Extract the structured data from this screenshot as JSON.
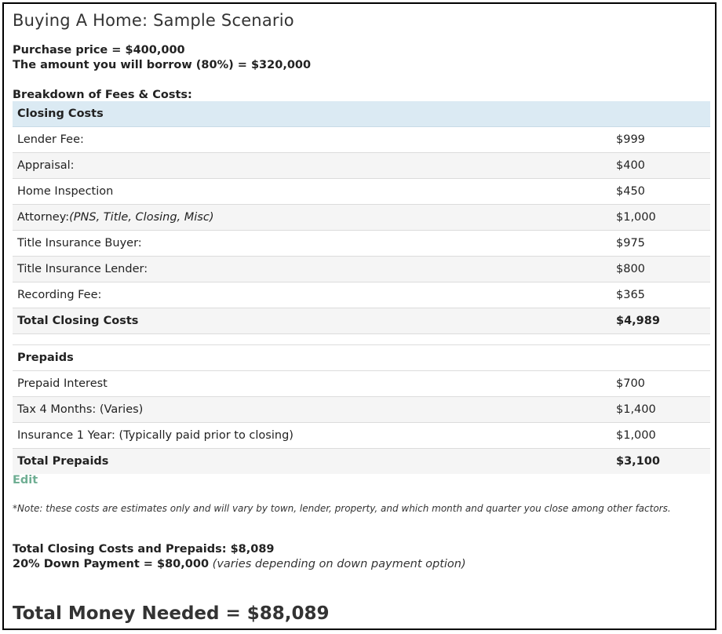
{
  "title": "Buying A Home: Sample Scenario",
  "purchase_line": "Purchase price = $400,000",
  "borrow_line": "The amount you will borrow (80%) = $320,000",
  "breakdown_heading": "Breakdown of Fees & Costs:",
  "closing_costs": {
    "header": "Closing Costs",
    "rows": [
      {
        "label": "Lender Fee:",
        "amount": "$999"
      },
      {
        "label": "Appraisal:",
        "amount": "$400"
      },
      {
        "label": "Home Inspection",
        "amount": "$450"
      },
      {
        "label": "Attorney:",
        "note": "(PNS, Title, Closing, Misc)",
        "amount": "$1,000"
      },
      {
        "label": "Title Insurance Buyer:",
        "amount": "$975"
      },
      {
        "label": "Title Insurance Lender:",
        "amount": "$800"
      },
      {
        "label": "Recording Fee:",
        "amount": "$365"
      }
    ],
    "total_label": "Total Closing Costs",
    "total_amount": "$4,989"
  },
  "prepaids": {
    "header": "Prepaids",
    "rows": [
      {
        "label": "Prepaid Interest",
        "amount": "$700"
      },
      {
        "label": "Tax 4 Months: (Varies)",
        "amount": "$1,400"
      },
      {
        "label": "Insurance 1 Year: (Typically paid prior to closing)",
        "amount": "$1,000"
      }
    ],
    "total_label": "Total Prepaids",
    "total_amount": "$3,100"
  },
  "edit_label": "Edit",
  "note": "*Note: these costs are estimates only and will vary by town, lender, property, and which month and quarter you close among other factors.",
  "summary": {
    "total_closing_prepaids": "Total Closing Costs and Prepaids: $8,089",
    "down_payment": "20% Down Payment = $80,000",
    "down_payment_note": "(varies depending on down payment option)"
  },
  "total_money": "Total Money Needed = $88,089"
}
